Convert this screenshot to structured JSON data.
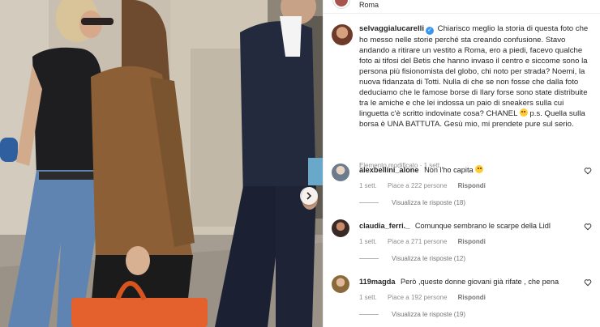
{
  "post": {
    "location": "Roma",
    "carousel_next_icon": "chevron-right-icon"
  },
  "caption": {
    "username": "selvaggialucarelli",
    "verified_icon": "verified-badge-icon",
    "text_part1": "Chiarisco meglio la storia di questa foto che ho messo nelle storie perché sta creando confusione. Stavo andando a ritirare un vestito a Roma, ero a piedi, facevo qualche foto ai tifosi del Betis che hanno invaso il centro e siccome sono la persona più fisionomista del globo, chi noto per strada? Noemi, la nuova fidanzata di Totti. Nulla di che se non fosse che dalla foto deduciamo che le famose borse di Ilary forse sono state distribuite tra le amiche e che lei indossa un paio di sneakers sulla cui linguetta c'è scritto indovinate cosa? CHANEL",
    "emoji_icon": "grinning-sweat-emoji-icon",
    "text_part2": "p.s. Quella sulla borsa è UNA BATTUTA. Gesù mio, mi prendete pure sul serio.",
    "edited_label": "Elemento modificato · 1 sett."
  },
  "comments": [
    {
      "username": "alexbellini_alone",
      "text": "Non l'ho capita",
      "has_emoji": true,
      "time": "1 sett.",
      "likes": "Piace a 222 persone",
      "reply_label": "Rispondi",
      "view_replies": "Visualizza le risposte (18)"
    },
    {
      "username": "claudia_ferri._",
      "text": "Comunque sembrano le scarpe della Lidl",
      "has_emoji": false,
      "time": "1 sett.",
      "likes": "Piace a 271 persone",
      "reply_label": "Rispondi",
      "view_replies": "Visualizza le risposte (12)"
    },
    {
      "username": "119magda",
      "text": "Però ,queste donne giovani già rifate , che pena",
      "has_emoji": false,
      "time": "1 sett.",
      "likes": "Piace a 192 persone",
      "reply_label": "Rispondi",
      "view_replies": "Visualizza le risposte (19)"
    }
  ],
  "icons": {
    "like": "heart-outline-icon"
  },
  "colors": {
    "verified": "#3897f0",
    "secondary_text": "#8e8e8e",
    "primary_text": "#262626"
  }
}
